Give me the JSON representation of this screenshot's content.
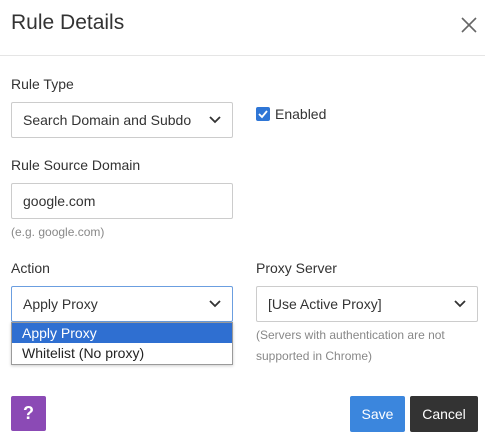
{
  "dialog": {
    "title": "Rule Details"
  },
  "rule_type": {
    "label": "Rule Type",
    "value": "Search Domain and Subdo"
  },
  "enabled": {
    "label": "Enabled",
    "checked": true
  },
  "rule_source": {
    "label": "Rule Source Domain",
    "value": "google.com",
    "hint": "(e.g. google.com)"
  },
  "action": {
    "label": "Action",
    "value": "Apply Proxy",
    "options": [
      "Apply Proxy",
      "Whitelist (No proxy)"
    ]
  },
  "proxy_server": {
    "label": "Proxy Server",
    "value": "[Use Active Proxy]",
    "hint_line1": "(Servers with authentication are not",
    "hint_line2": "supported in Chrome)"
  },
  "footer": {
    "help_label": "?",
    "save_label": "Save",
    "cancel_label": "Cancel"
  },
  "colors": {
    "accent": "#3b86dd",
    "help": "#8b4ab5",
    "cancel": "#333333",
    "selected_option": "#2f6fd1"
  }
}
